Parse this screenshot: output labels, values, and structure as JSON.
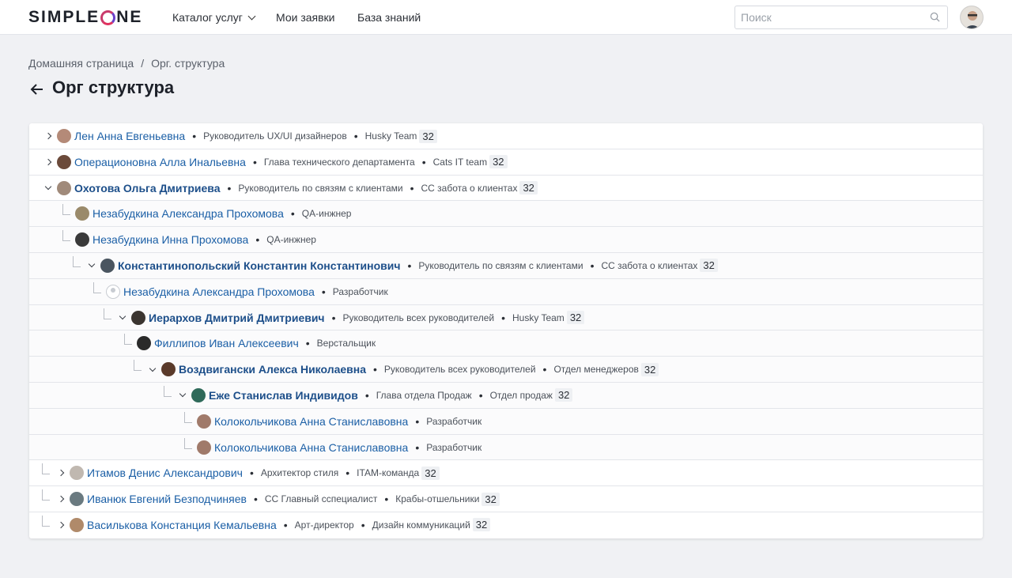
{
  "header": {
    "logo": "SIMPLE",
    "logo_tail": "NE",
    "nav": {
      "catalog": "Каталог услуг",
      "requests": "Мои заявки",
      "kb": "База знаний"
    },
    "search_placeholder": "Поиск"
  },
  "breadcrumb": {
    "home": "Домашняя страница",
    "separator": "/",
    "current": "Орг. структура"
  },
  "page_title": "Орг структура",
  "colors": {
    "link": "#1b5fa6",
    "row_border": "#e3e5ea",
    "background": "#f0f1f4"
  },
  "rows": [
    {
      "name": "Лен Анна Евгеньевна",
      "role": "Руководитель UX/UI дизайнеров",
      "team": "Husky Team",
      "count": "32",
      "toggle": "collapsed",
      "bold": false,
      "avatar": "#b48a78"
    },
    {
      "name": "Операционовна Алла Инальевна",
      "role": "Глава технического департамента",
      "team": "Cats IT team",
      "count": "32",
      "toggle": "collapsed",
      "bold": false,
      "avatar": "#6b4a3a"
    },
    {
      "name": "Охотова Ольга Дмитриева",
      "role": "Руководитель по связям с клиентами",
      "team": "СС забота о клиентах",
      "count": "32",
      "toggle": "expanded",
      "bold": true,
      "avatar": "#a08a7a"
    },
    {
      "name": "Незабудкина Александра Прохомова",
      "role": "QA-инжнер",
      "toggle": "leaf",
      "bold": false,
      "avatar": "#9a8a6a"
    },
    {
      "name": "Незабудкина Инна Прохомова",
      "role": "QA-инжнер",
      "toggle": "leaf",
      "bold": false,
      "avatar": "#3a3a3a"
    },
    {
      "name": "Константинопольский Константин Константинович",
      "role": "Руководитель по связям с клиентами",
      "team": "СС забота о клиентах",
      "count": "32",
      "toggle": "expanded",
      "bold": true,
      "avatar": "#4a5560"
    },
    {
      "name": "Незабудкина Александра Прохомова",
      "role": "Разработчик",
      "toggle": "leaf",
      "bold": false,
      "avatar": "empty"
    },
    {
      "name": "Иерархов Дмитрий Дмитриевич",
      "role": "Руководитель всех руководителей",
      "team": "Husky Team",
      "count": "32",
      "toggle": "expanded",
      "bold": true,
      "avatar": "#3b3530"
    },
    {
      "name": "Филлипов Иван Алексеевич",
      "role": "Верстальщик",
      "toggle": "leaf",
      "bold": false,
      "avatar": "#2a2a2a"
    },
    {
      "name": "Воздвигански Алекса Николаевна",
      "role": "Руководитель всех руководителей",
      "team": "Отдел менеджеров",
      "count": "32",
      "toggle": "expanded",
      "bold": true,
      "avatar": "#5a3a2a"
    },
    {
      "name": "Еже Станислав Индивидов",
      "role": "Глава отдела Продаж",
      "team": "Отдел продаж",
      "count": "32",
      "toggle": "expanded",
      "bold": true,
      "avatar": "#2f6a5a"
    },
    {
      "name": "Колокольчикова Анна Станиславовна",
      "role": "Разработчик",
      "toggle": "leaf",
      "bold": false,
      "avatar": "#a07a6a"
    },
    {
      "name": "Колокольчикова Анна Станиславовна",
      "role": "Разработчик",
      "toggle": "leaf",
      "bold": false,
      "avatar": "#a07a6a"
    },
    {
      "name": "Итамов Денис Александрович",
      "role": "Архитектор стиля",
      "team": "ITAM-команда",
      "count": "32",
      "toggle": "collapsed",
      "bold": false,
      "avatar": "#c0b8b0"
    },
    {
      "name": "Иванюк  Евгений Безподчиняев",
      "role": "СС Главный сспециалист",
      "team": "Крабы-отшельники",
      "count": "32",
      "toggle": "collapsed",
      "bold": false,
      "avatar": "#6a7a80"
    },
    {
      "name": "Василькова Констанция Кемальевна",
      "role": "Арт-директор",
      "team": "Дизайн коммуникаций",
      "count": "32",
      "toggle": "collapsed",
      "bold": false,
      "avatar": "#b08a6a"
    }
  ]
}
